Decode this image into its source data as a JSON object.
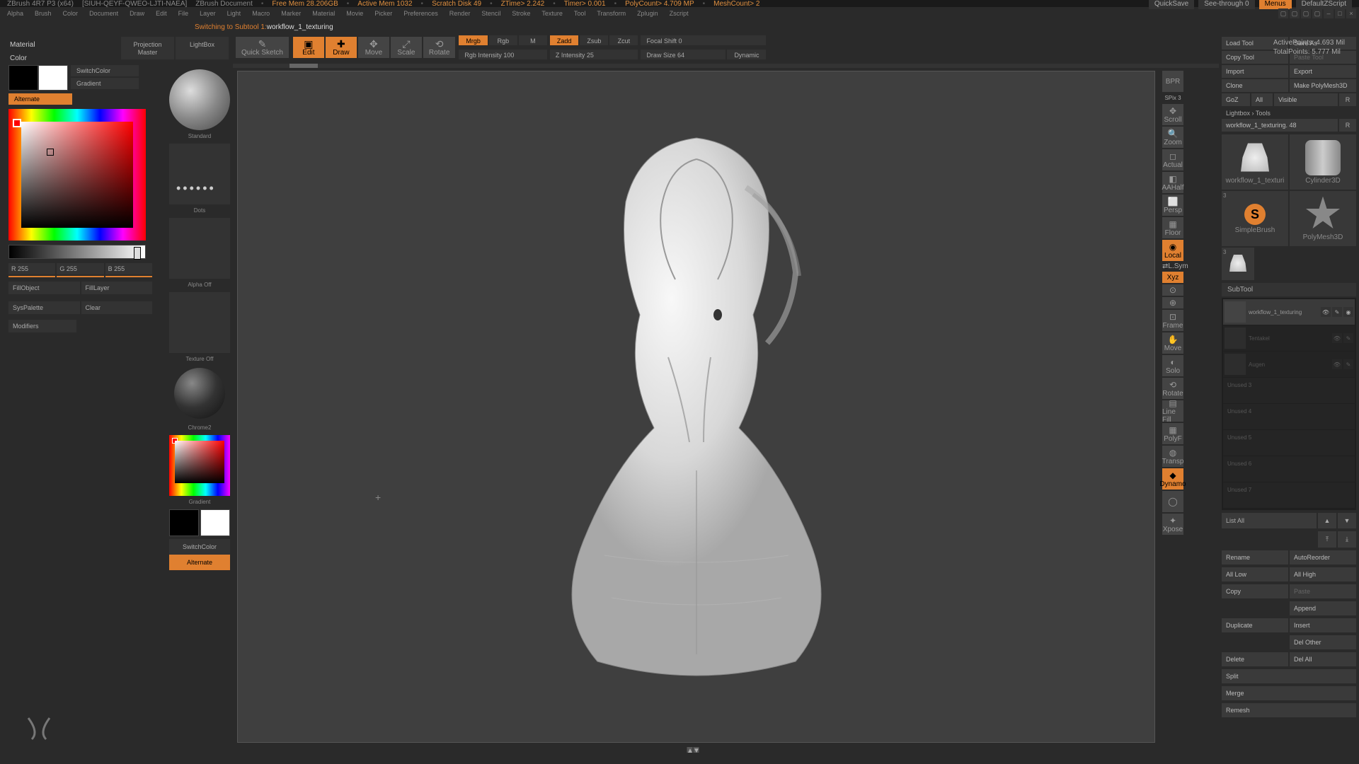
{
  "title_bar": {
    "app": "ZBrush 4R7 P3 (x64)",
    "doc_id": "[SIUH-QEYF-QWEO-LJTI-NAEA]",
    "doc_name": "ZBrush Document",
    "stats": [
      "Free Mem 28.206GB",
      "Active Mem 1032",
      "Scratch Disk 49",
      "ZTime> 2.242",
      "Timer> 0.001",
      "PolyCount> 4.709 MP",
      "MeshCount> 2"
    ],
    "quicksave": "QuickSave",
    "seethrough": "See-through   0",
    "menus": "Menus",
    "defscript": "DefaultZScript"
  },
  "menu": [
    "Alpha",
    "Brush",
    "Color",
    "Document",
    "Draw",
    "Edit",
    "File",
    "Layer",
    "Light",
    "Macro",
    "Marker",
    "Material",
    "Movie",
    "Picker",
    "Preferences",
    "Render",
    "Stencil",
    "Stroke",
    "Texture",
    "Tool",
    "Transform",
    "Zplugin",
    "Zscript"
  ],
  "status": {
    "prefix": "Switching to Subtool 1:  ",
    "name": "workflow_1_texturing"
  },
  "left": {
    "material": "Material",
    "color": "Color",
    "switchcolor": "SwitchColor",
    "gradient": "Gradient",
    "alternate": "Alternate",
    "r": "R 255",
    "g": "G 255",
    "b": "B 255",
    "fillobject": "FillObject",
    "filllayer": "FillLayer",
    "syspalette": "SysPalette",
    "clear": "Clear",
    "modifiers": "Modifiers"
  },
  "strip": {
    "projection": "Projection Master",
    "lightbox": "LightBox",
    "standard": "Standard",
    "dots": "Dots",
    "alpha_off": "Alpha Off",
    "texture_off": "Texture Off",
    "chrome": "Chrome2",
    "gradient": "Gradient",
    "switchcolor": "SwitchColor",
    "alternate": "Alternate"
  },
  "toolbar": {
    "quicksketch": "Quick Sketch",
    "edit": "Edit",
    "draw": "Draw",
    "move": "Move",
    "scale": "Scale",
    "rotate": "Rotate",
    "mrgb": "Mrgb",
    "rgb": "Rgb",
    "m": "M",
    "rgb_intensity": "Rgb Intensity 100",
    "zadd": "Zadd",
    "zsub": "Zsub",
    "zcut": "Zcut",
    "z_intensity": "Z Intensity 25",
    "focal_shift": "Focal Shift 0",
    "draw_size": "Draw Size 64",
    "dynamic": "Dynamic",
    "activepoints": "ActivePoints: 4.693 Mil",
    "totalpoints": "TotalPoints: 5.777 Mil"
  },
  "right_tools": {
    "spix": "SPix 3",
    "items": [
      "BPR",
      "Scroll",
      "Zoom",
      "Actual",
      "AAHalf",
      "Persp",
      "Floor",
      "Local",
      "L.Sym",
      "Xyz",
      "",
      "",
      "Frame",
      "Move",
      "Solo",
      "Rotate",
      "Line Fill",
      "PolyF",
      "Transp",
      "Dynamo",
      "",
      "Xpose"
    ]
  },
  "right_panel": {
    "load": "Load Tool",
    "save": "Save As",
    "copy": "Copy Tool",
    "paste": "Paste Tool",
    "import": "Import",
    "export": "Export",
    "clone": "Clone",
    "makepm": "Make PolyMesh3D",
    "goz": "GoZ",
    "all": "All",
    "visible": "Visible",
    "r": "R",
    "lightbox": "Lightbox › Tools",
    "current": "workflow_1_texturing. 48",
    "thumbs": [
      "workflow_1_texturi",
      "Cylinder3D",
      "SimpleBrush",
      "PolyMesh3D",
      "workflow_1_texturi"
    ],
    "subtool": "SubTool",
    "subtools": [
      "workflow_1_texturing",
      "Tentakel",
      "Augen"
    ],
    "empty_slots": [
      "Unused 3",
      "Unused 4",
      "Unused 5",
      "Unused 6",
      "Unused 7"
    ],
    "list_all": "List All",
    "rename": "Rename",
    "autoreorder": "AutoReorder",
    "alllow": "All Low",
    "allhigh": "All High",
    "copy2": "Copy",
    "paste2": "Paste",
    "append": "Append",
    "duplicate": "Duplicate",
    "insert": "Insert",
    "delother": "Del Other",
    "delete": "Delete",
    "delall": "Del All",
    "split": "Split",
    "merge": "Merge",
    "remesh": "Remesh"
  }
}
